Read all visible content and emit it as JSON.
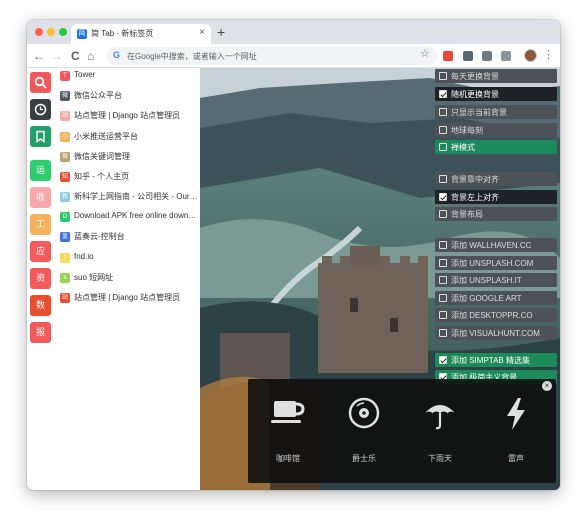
{
  "browser": {
    "tab": {
      "favicon": "简",
      "title": "简 Tab - 新标签页",
      "close": "×"
    },
    "new_tab": "+",
    "nav": {
      "back": "←",
      "forward": "→",
      "reload": "C",
      "home": "⌂"
    },
    "omnibox": {
      "g": "G",
      "placeholder": "在Google中搜索，或者输入一个网址"
    },
    "star": "☆",
    "menu": "⋮"
  },
  "rail": {
    "items": [
      {
        "name": "search",
        "label": "",
        "color": "#f2585a"
      },
      {
        "name": "history",
        "label": "",
        "color": "#3b3f44"
      },
      {
        "name": "bookmark",
        "label": "",
        "color": "#23a06a"
      },
      {
        "name": "apps",
        "label": "运",
        "color": "#2ecc71"
      },
      {
        "name": "collect",
        "label": "收",
        "color": "#f7a8a8"
      },
      {
        "name": "tools",
        "label": "工",
        "color": "#f5b25c"
      },
      {
        "name": "apps2",
        "label": "应",
        "color": "#f25a5c"
      },
      {
        "name": "resources",
        "label": "资",
        "color": "#f25a5c"
      },
      {
        "name": "data",
        "label": "数",
        "color": "#e84e31"
      },
      {
        "name": "news",
        "label": "报",
        "color": "#f25a5c"
      }
    ]
  },
  "bookmarks": [
    {
      "title": "Tower",
      "icon": "T",
      "color": "#f2585a"
    },
    {
      "title": "微信公众平台",
      "icon": "微",
      "color": "#4f5a63"
    },
    {
      "title": "站点管理 | Django 站点管理员",
      "icon": "站",
      "color": "#f7a8a8"
    },
    {
      "title": "小米推送运营平台",
      "icon": "小",
      "color": "#f5b25c"
    },
    {
      "title": "微信关键词管理",
      "icon": "微",
      "color": "#b9a56c"
    },
    {
      "title": "知乎 - 个人主页",
      "icon": "知",
      "color": "#e84e31"
    },
    {
      "title": "新科学上网指南 - 公司相关 - Ourbri",
      "icon": "新",
      "color": "#8ecae6"
    },
    {
      "title": "Download APK free online downloa...",
      "icon": "D",
      "color": "#2ecc71"
    },
    {
      "title": "蓝奏云-控制台",
      "icon": "蓝",
      "color": "#3f6fd8"
    },
    {
      "title": "fnd.io",
      "icon": "f",
      "color": "#f7d95c"
    },
    {
      "title": "suo 短网址",
      "icon": "s",
      "color": "#9bd35a"
    },
    {
      "title": "站点管理 | Django 站点管理员",
      "icon": "站",
      "color": "#e84e31"
    }
  ],
  "options": [
    {
      "label": "每天更换背景",
      "checked": false,
      "style": "grey"
    },
    {
      "label": "随机更换背景",
      "checked": true,
      "style": "dark"
    },
    {
      "label": "只显示当前背景",
      "checked": false,
      "style": "grey"
    },
    {
      "label": "地球每刻",
      "checked": false,
      "style": "grey"
    },
    {
      "label": "禅模式",
      "checked": false,
      "style": "green"
    },
    {
      "label": "背景靠中对齐",
      "checked": false,
      "style": "grey"
    },
    {
      "label": "背景左上对齐",
      "checked": true,
      "style": "dark"
    },
    {
      "label": "背景布局",
      "checked": false,
      "style": "grey"
    },
    {
      "label": "添加 WALLHAVEN.CC",
      "checked": false,
      "style": "grey"
    },
    {
      "label": "添加 UNSPLASH.COM",
      "checked": false,
      "style": "grey"
    },
    {
      "label": "添加 UNSPLASH.IT",
      "checked": false,
      "style": "grey"
    },
    {
      "label": "添加 GOOGLE ART",
      "checked": false,
      "style": "grey"
    },
    {
      "label": "添加 DESKTOPPR.CO",
      "checked": false,
      "style": "grey"
    },
    {
      "label": "添加 VISUALHUNT.COM",
      "checked": false,
      "style": "grey"
    },
    {
      "label": "添加 SIMPTAB 精选集",
      "checked": true,
      "style": "green"
    },
    {
      "label": "添加 极简主义背景",
      "checked": true,
      "style": "green"
    }
  ],
  "sounds": [
    {
      "label": "咖啡馆",
      "icon": "coffee-cup-icon"
    },
    {
      "label": "爵士乐",
      "icon": "vinyl-record-icon"
    },
    {
      "label": "下雨天",
      "icon": "umbrella-icon"
    },
    {
      "label": "雷声",
      "icon": "lightning-icon"
    }
  ],
  "sound_close": "×"
}
